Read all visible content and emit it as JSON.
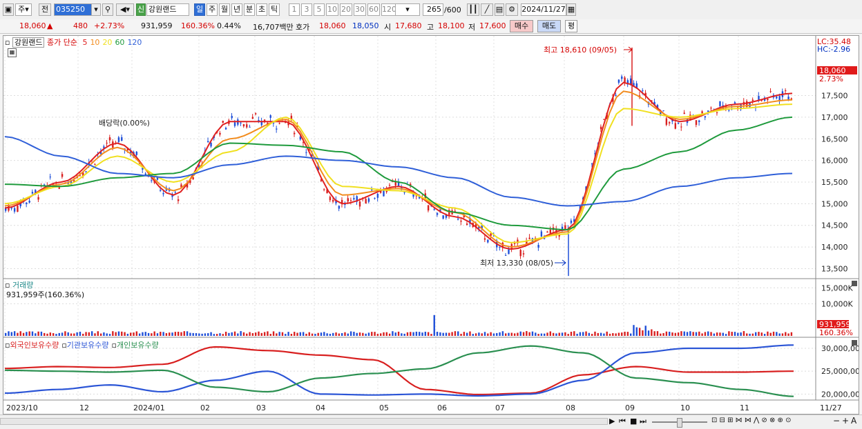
{
  "toolbar": {
    "period_type": "주",
    "prev": "전",
    "code": "035250",
    "new_badge": "신",
    "stock_name": "강원랜드",
    "tabs": [
      "일",
      "주",
      "월",
      "년",
      "분",
      "초",
      "틱"
    ],
    "counts": [
      "1",
      "3",
      "5",
      "10",
      "20",
      "30",
      "60",
      "120"
    ],
    "bar_count": "265",
    "bar_total": "/600",
    "date": "2024/11/27"
  },
  "quote": {
    "price": "18,060",
    "change_arrow": "▲",
    "change": "480",
    "change_pct": "+2.73%",
    "volume": "931,959",
    "volume_ratio": "160.36%",
    "turnover": "0.44%",
    "amount": "16,707백만",
    "bid_label": "호가",
    "ask_price": "18,060",
    "bid_price": "18,050",
    "open_label": "시",
    "open": "17,680",
    "high_label": "고",
    "high": "18,100",
    "low_label": "저",
    "low": "17,600",
    "buy_label": "매수",
    "sell_label": "매도",
    "avg_label": "평"
  },
  "price_panel": {
    "legend_name": "강원랜드",
    "legend_series": "종가 단순",
    "ma_labels": [
      "5",
      "10",
      "20",
      "60",
      "120"
    ],
    "ma_colors": [
      "#e02020",
      "#f28c1e",
      "#f0e020",
      "#1e9a3c",
      "#2f5fd8"
    ],
    "lc_label": "LC:35.48",
    "hc_label": "HC:-2.96",
    "dividend_label": "배당락(0.00%)",
    "high_annotation": "최고 18,610 (09/05)",
    "low_annotation": "최저 13,330 (08/05)",
    "last_price_tag": "18,060",
    "last_pct_tag": "2.73%",
    "y_ticks": [
      "17,500",
      "17,000",
      "16,500",
      "16,000",
      "15,500",
      "15,000",
      "14,500",
      "14,000",
      "13,500"
    ]
  },
  "volume_panel": {
    "title": "거래량",
    "value_label": "931,959주(160.36%)",
    "y_ticks": [
      "15,000K",
      "10,000K"
    ],
    "last_tag": "931,959",
    "last_pct": "160.36%"
  },
  "holding_panel": {
    "labels": [
      "외국인보유수량",
      "기관보유수량",
      "개인보유수량"
    ],
    "colors": [
      "#d81f1f",
      "#2b55d6",
      "#2a8f50"
    ],
    "y_ticks": [
      "30,000,000",
      "25,000,000",
      "20,000,000"
    ]
  },
  "x_axis": {
    "labels": [
      "2023/10",
      "12",
      "2024/01",
      "02",
      "03",
      "04",
      "05",
      "06",
      "07",
      "08",
      "09",
      "10",
      "11",
      "11/27"
    ]
  },
  "chart_data": {
    "type": "line",
    "title": "",
    "xlabel": "",
    "ylabel": "",
    "ylim": [
      13300,
      18800
    ],
    "x": [
      "2023/10",
      "12",
      "2024/01",
      "02",
      "03",
      "04",
      "05",
      "06",
      "07",
      "08",
      "09",
      "10",
      "11",
      "11/27"
    ],
    "series": [
      {
        "name": "5",
        "values": [
          14900,
          15500,
          16400,
          15200,
          16900,
          16900,
          15000,
          15400,
          14700,
          13950,
          14400,
          17800,
          16900,
          17300,
          17550
        ]
      },
      {
        "name": "10",
        "values": [
          14950,
          15450,
          16300,
          15300,
          16500,
          16950,
          15200,
          15350,
          14800,
          14000,
          14350,
          17600,
          16950,
          17250,
          17400
        ]
      },
      {
        "name": "20",
        "values": [
          15000,
          15400,
          16100,
          15500,
          16200,
          17000,
          15400,
          15300,
          14900,
          14100,
          14300,
          17200,
          17000,
          17200,
          17300
        ]
      },
      {
        "name": "60",
        "values": [
          15450,
          15400,
          15600,
          15700,
          16400,
          16350,
          16200,
          15500,
          14800,
          14500,
          14400,
          15800,
          16200,
          16700,
          17000
        ]
      },
      {
        "name": "120",
        "values": [
          16550,
          16100,
          15700,
          15600,
          15900,
          16100,
          16000,
          15850,
          15600,
          15150,
          14950,
          15050,
          15400,
          15600,
          15700
        ]
      }
    ],
    "price_high": 18610,
    "price_low": 13330,
    "last": 18060
  }
}
